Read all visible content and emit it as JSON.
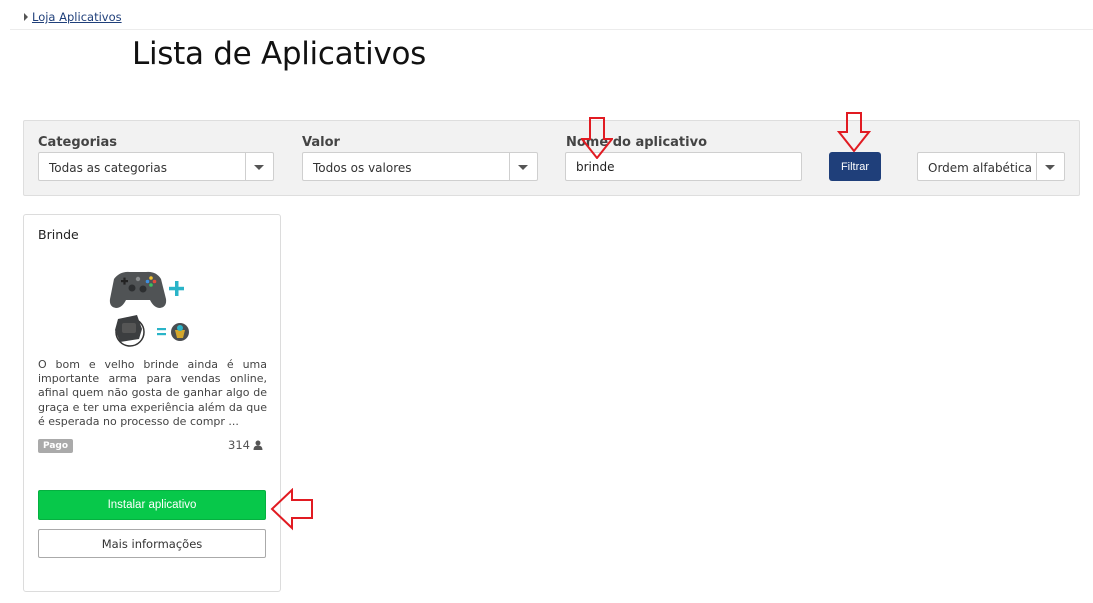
{
  "breadcrumb": {
    "link": "Loja Aplicativos"
  },
  "page": {
    "title": "Lista de Aplicativos"
  },
  "filters": {
    "categories": {
      "label": "Categorias",
      "value": "Todas as categorias"
    },
    "price": {
      "label": "Valor",
      "value": "Todos os valores"
    },
    "name": {
      "label": "Nome do aplicativo",
      "value": "brinde"
    },
    "filter_button": "Filtrar",
    "sort": {
      "value": "Ordem alfabética"
    }
  },
  "apps": [
    {
      "name": "Brinde",
      "image_icon": "game-controller-and-gift-icon",
      "description": "O bom e velho brinde ainda é uma importante arma para vendas online, afinal quem não gosta de ganhar algo de graça e ter uma experiência além da que é esperada no processo de compr ...",
      "badge": "Pago",
      "installs": "314",
      "install_button": "Instalar aplicativo",
      "more_button": "Mais informações"
    }
  ],
  "colors": {
    "primary": "#1f3f7a",
    "install": "#07c84a",
    "annotation": "#e11b22"
  }
}
